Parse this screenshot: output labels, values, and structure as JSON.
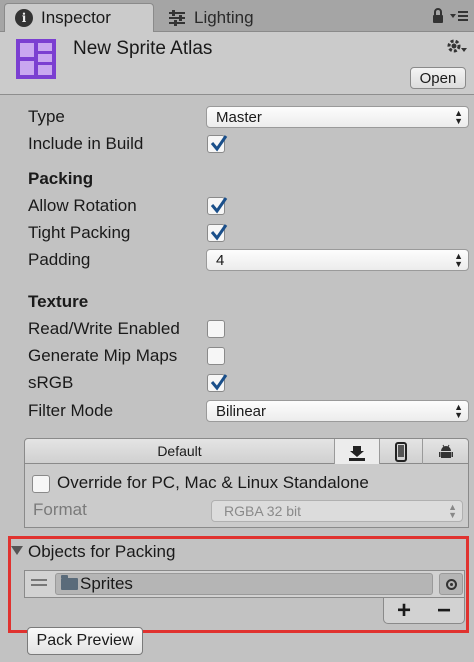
{
  "tabs": [
    {
      "label": "Inspector",
      "icon": "info-icon",
      "active": true
    },
    {
      "label": "Lighting",
      "icon": "sliders-icon",
      "active": false
    }
  ],
  "header": {
    "title": "New Sprite Atlas",
    "open_label": "Open",
    "icon_color": "#7b3fd1"
  },
  "fields": {
    "type": {
      "label": "Type",
      "value": "Master"
    },
    "include_in_build": {
      "label": "Include in Build",
      "checked": true
    }
  },
  "packing": {
    "title": "Packing",
    "allow_rotation": {
      "label": "Allow Rotation",
      "checked": true
    },
    "tight_packing": {
      "label": "Tight Packing",
      "checked": true
    },
    "padding": {
      "label": "Padding",
      "value": "4"
    }
  },
  "texture": {
    "title": "Texture",
    "read_write": {
      "label": "Read/Write Enabled",
      "checked": false
    },
    "mip_maps": {
      "label": "Generate Mip Maps",
      "checked": false
    },
    "srgb": {
      "label": "sRGB",
      "checked": true
    },
    "filter_mode": {
      "label": "Filter Mode",
      "value": "Bilinear"
    }
  },
  "platform": {
    "default_tab": "Default",
    "override_label": "Override for PC, Mac & Linux Standalone",
    "override_checked": false,
    "format_label": "Format",
    "format_value": "RGBA 32 bit"
  },
  "objects": {
    "title": "Objects for Packing",
    "items": [
      {
        "name": "Sprites",
        "icon": "folder-icon"
      }
    ],
    "add_label": "+",
    "remove_label": "−"
  },
  "pack_preview_label": "Pack Preview",
  "colors": {
    "highlight": "#e0322f",
    "check": "#1a4f8a"
  }
}
